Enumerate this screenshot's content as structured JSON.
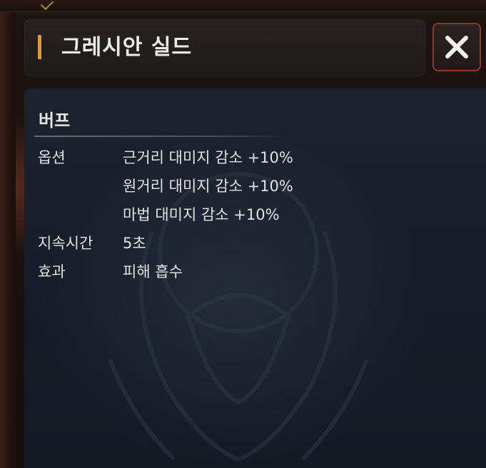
{
  "header": {
    "title": "그레시안 실드"
  },
  "close_button": {
    "icon": "close-icon"
  },
  "buff": {
    "section_title": "버프",
    "option_label": "옵션",
    "options": [
      "근거리 대미지 감소 +10%",
      "원거리 대미지 감소 +10%",
      "마법 대미지 감소 +10%"
    ],
    "duration_label": "지속시간",
    "duration_value": "5초",
    "effect_label": "효과",
    "effect_value": "피해 흡수"
  },
  "colors": {
    "accent": "#e8952c",
    "close_border": "#8a3a28",
    "panel_bg": "#1b2330",
    "text": "#e2e2e2"
  }
}
